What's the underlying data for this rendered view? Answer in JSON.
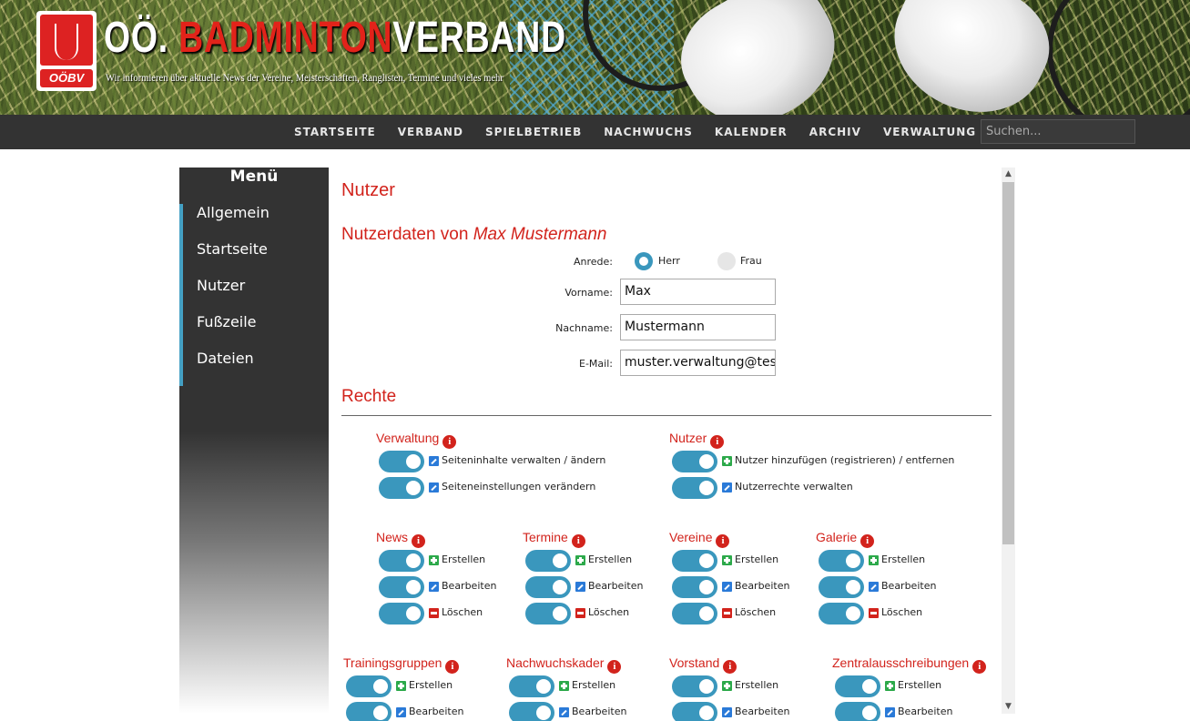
{
  "header": {
    "logo_text": "OÖBV",
    "title_part1": "OÖ. ",
    "title_part2": "BADMINTON",
    "title_part3": "VERBAND",
    "subtitle": "Wir informieren über aktuelle News der Vereine, Meisterschaften, Ranglisten, Termine und vieles mehr"
  },
  "nav": {
    "items": [
      "Startseite",
      "Verband",
      "Spielbetrieb",
      "Nachwuchs",
      "Kalender",
      "Archiv",
      "Verwaltung"
    ],
    "search_placeholder": "Suchen..."
  },
  "sidebar": {
    "title": "Menü",
    "items": [
      "Allgemein",
      "Startseite",
      "Nutzer",
      "Fußzeile",
      "Dateien"
    ]
  },
  "page": {
    "title": "Nutzer",
    "userdata_heading_prefix": "Nutzerdaten von ",
    "userdata_heading_name": "Max Mustermann",
    "form": {
      "salutation_label": "Anrede:",
      "salutation_options": [
        "Herr",
        "Frau"
      ],
      "salutation_selected": "Herr",
      "firstname_label": "Vorname:",
      "firstname_value": "Max",
      "lastname_label": "Nachname:",
      "lastname_value": "Mustermann",
      "email_label": "E-Mail:",
      "email_value": "muster.verwaltung@test"
    },
    "rights_heading": "Rechte",
    "groups": {
      "verwaltung": {
        "title": "Verwaltung",
        "perms": [
          {
            "icon": "edit-icon",
            "label": "Seiteninhalte verwalten / ändern",
            "enabled": true
          },
          {
            "icon": "edit-icon",
            "label": "Seiteneinstellungen verändern",
            "enabled": true
          }
        ]
      },
      "nutzer": {
        "title": "Nutzer",
        "perms": [
          {
            "icon": "add-icon",
            "label": "Nutzer hinzufügen (registrieren) / entfernen",
            "enabled": true
          },
          {
            "icon": "edit-icon",
            "label": "Nutzerrechte verwalten",
            "enabled": true
          }
        ]
      },
      "news": {
        "title": "News",
        "perms": [
          "Erstellen",
          "Bearbeiten",
          "Löschen"
        ]
      },
      "termine": {
        "title": "Termine",
        "perms": [
          "Erstellen",
          "Bearbeiten",
          "Löschen"
        ]
      },
      "vereine": {
        "title": "Vereine",
        "perms": [
          "Erstellen",
          "Bearbeiten",
          "Löschen"
        ]
      },
      "galerie": {
        "title": "Galerie",
        "perms": [
          "Erstellen",
          "Bearbeiten",
          "Löschen"
        ]
      },
      "trainingsgruppen": {
        "title": "Trainingsgruppen",
        "perms": [
          "Erstellen",
          "Bearbeiten"
        ]
      },
      "nachwuchskader": {
        "title": "Nachwuchskader",
        "perms": [
          "Erstellen",
          "Bearbeiten"
        ]
      },
      "vorstand": {
        "title": "Vorstand",
        "perms": [
          "Erstellen",
          "Bearbeiten"
        ]
      },
      "zentralausschreibungen": {
        "title": "Zentralausschreibungen",
        "perms": [
          "Erstellen",
          "Bearbeiten"
        ]
      }
    },
    "info_glyph": "i"
  },
  "colors": {
    "accent_red": "#d2231c",
    "toggle_blue": "#3a97bd",
    "nav_bg": "#333333",
    "add_green": "#2ca94a",
    "edit_blue": "#2a7ad8"
  }
}
